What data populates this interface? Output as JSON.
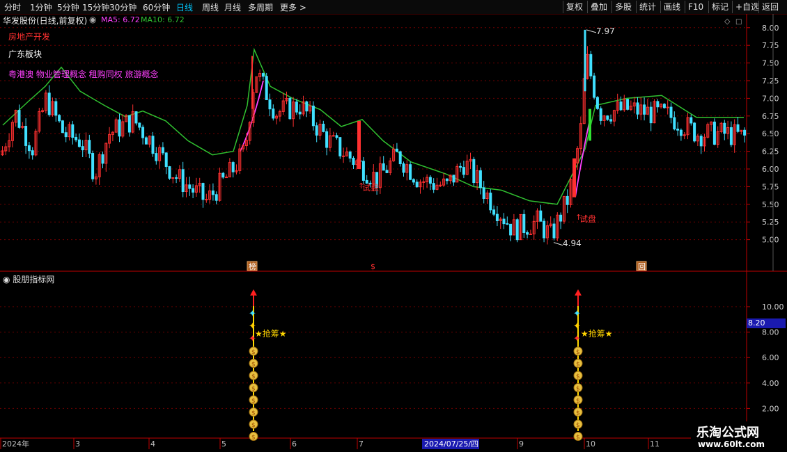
{
  "toolbar": {
    "periods": [
      "分时",
      "1分钟",
      "5分钟",
      "15分钟",
      "30分钟",
      "60分钟",
      "日线",
      "周线",
      "月线",
      "多周期",
      "更多 >"
    ],
    "active_period": "日线",
    "right_buttons": [
      "复权",
      "叠加",
      "多股",
      "统计",
      "画线",
      "F10",
      "标记",
      "+自选",
      "返回"
    ]
  },
  "main_chart": {
    "title": "华发股份(日线,前复权)",
    "ma5_label": "MA5: 6.72",
    "ma10_label": "MA10: 6.72",
    "sector1": "房地产开发",
    "sector2": "广东板块",
    "concepts": "粤港澳 物业管理概念 租购同权 旅游概念",
    "high_label": "7.97",
    "low_label": "4.94",
    "signal_label": "试盘",
    "markers": [
      "榜",
      "$",
      "回"
    ],
    "colors": {
      "up": "#ff3030",
      "down": "#40e0ff",
      "ma": "#30c030",
      "ma_hot": "#ff40ff",
      "grid": "#700000",
      "axis": "#c00000"
    }
  },
  "chart_data": {
    "type": "candlestick",
    "price_axis_ticks": [
      "8.00",
      "7.75",
      "7.50",
      "7.25",
      "7.00",
      "6.75",
      "6.50",
      "6.25",
      "6.00",
      "5.75",
      "5.50",
      "5.25",
      "5.00"
    ],
    "ylim": [
      4.75,
      8.1
    ],
    "highest": 7.97,
    "lowest": 4.94,
    "ma_series_name": "MA10",
    "ma10_key_points": [
      6.62,
      6.95,
      7.17,
      7.44,
      7.1,
      6.9,
      6.74,
      6.82,
      6.68,
      6.4,
      6.2,
      6.25,
      6.9,
      7.69,
      7.17,
      7.0,
      6.84,
      6.6,
      6.7,
      6.4,
      6.1,
      5.93,
      5.75,
      5.7,
      5.55,
      5.5,
      6.28,
      6.9,
      7.0,
      6.73,
      7.04,
      6.73
    ],
    "candles_description": "daily candles Jan–Nov 2024"
  },
  "indicator": {
    "title": "股朋指标网",
    "signal_text": "★抢筹★",
    "axis_ticks": [
      "10.00",
      "8.00",
      "6.00",
      "4.00",
      "2.00"
    ],
    "current_value": "8.20"
  },
  "date_axis": {
    "labels": [
      "2024年",
      "3",
      "4",
      "5",
      "6",
      "7",
      "9",
      "10",
      "11"
    ],
    "highlight": "2024/07/25/四"
  },
  "watermark": {
    "line1": "乐淘公式网",
    "line2": "www.60lt.com"
  }
}
